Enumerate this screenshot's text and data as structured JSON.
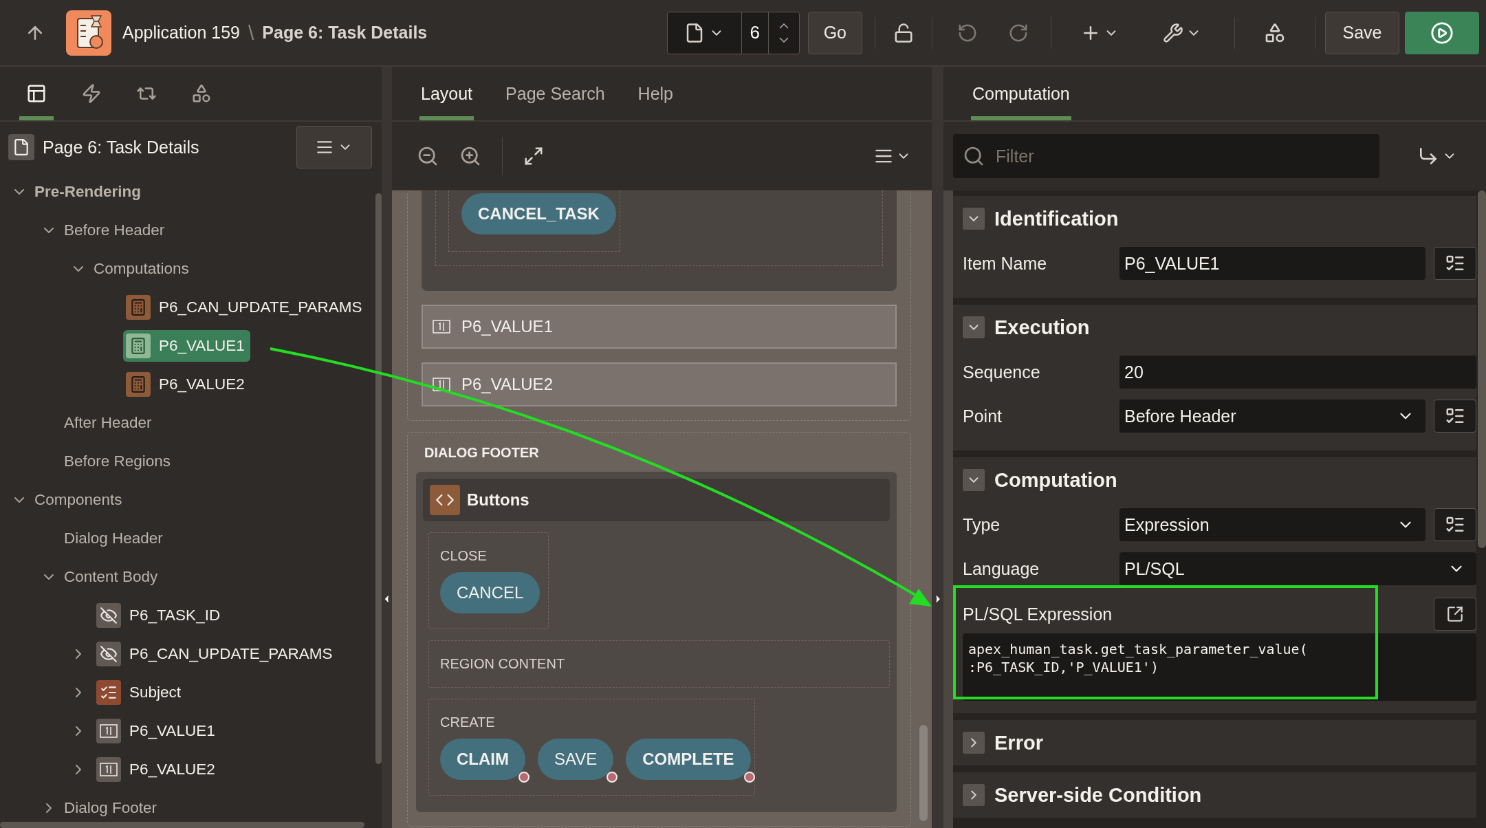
{
  "header": {
    "app": "Application 159",
    "separator": "\\",
    "page": "Page 6: Task Details",
    "page_number": "6",
    "go": "Go",
    "save": "Save"
  },
  "left_panel": {
    "tabs": [
      {
        "kind": "rendering",
        "selected": true
      },
      {
        "kind": "dynamic-actions",
        "selected": false
      },
      {
        "kind": "processing",
        "selected": false
      },
      {
        "kind": "shared",
        "selected": false
      }
    ],
    "title": "Page 6: Task Details",
    "tree": [
      {
        "label": "Pre-Rendering",
        "bold": true,
        "expanded": true,
        "selected": false,
        "children": [
          {
            "label": "Before Header",
            "expanded": true,
            "selected": false,
            "children": [
              {
                "label": "Computations",
                "expanded": true,
                "selected": false,
                "children": [
                  {
                    "label": "P6_CAN_UPDATE_PARAMS",
                    "kind": "computation",
                    "selected": false
                  },
                  {
                    "label": "P6_VALUE1",
                    "kind": "computation",
                    "selected": true
                  },
                  {
                    "label": "P6_VALUE2",
                    "kind": "computation",
                    "selected": false
                  }
                ]
              }
            ]
          },
          {
            "label": "After Header",
            "selected": false
          },
          {
            "label": "Before Regions",
            "selected": false
          }
        ]
      },
      {
        "label": "Components",
        "bold": false,
        "expanded": true,
        "selected": false,
        "children": [
          {
            "label": "Dialog Header",
            "selected": false
          },
          {
            "label": "Content Body",
            "expanded": true,
            "selected": false,
            "children": [
              {
                "label": "P6_TASK_ID",
                "kind": "hidden",
                "selected": false
              },
              {
                "label": "P6_CAN_UPDATE_PARAMS",
                "kind": "hidden",
                "expanded": false,
                "selected": false
              },
              {
                "label": "Subject",
                "kind": "checklist",
                "expanded": false,
                "selected": false
              },
              {
                "label": "P6_VALUE1",
                "kind": "number",
                "expanded": false,
                "selected": false
              },
              {
                "label": "P6_VALUE2",
                "kind": "number",
                "expanded": false,
                "selected": false
              }
            ]
          },
          {
            "label": "Dialog Footer",
            "expanded": false,
            "selected": false
          }
        ]
      }
    ]
  },
  "middle_panel": {
    "tabs": [
      {
        "label": "Layout",
        "selected": true
      },
      {
        "label": "Page Search",
        "selected": false
      },
      {
        "label": "Help",
        "selected": false
      }
    ],
    "canvas": {
      "top_buttons": [
        {
          "label": "CANCEL_TASK",
          "hot": true,
          "conditional": false
        }
      ],
      "items": [
        {
          "label": "P6_VALUE1"
        },
        {
          "label": "P6_VALUE2"
        }
      ],
      "footer": {
        "title": "DIALOG FOOTER",
        "region": "Buttons",
        "slots": [
          {
            "label": "CLOSE",
            "buttons": [
              {
                "label": "CANCEL",
                "hot": false,
                "conditional": false
              }
            ]
          },
          {
            "label": "REGION CONTENT"
          },
          {
            "label": "CREATE",
            "buttons": [
              {
                "label": "CLAIM",
                "hot": true,
                "conditional": true
              },
              {
                "label": "SAVE",
                "hot": false,
                "conditional": true
              },
              {
                "label": "COMPLETE",
                "hot": true,
                "conditional": true
              }
            ]
          }
        ]
      }
    }
  },
  "right_panel": {
    "tabs": [
      {
        "label": "Computation",
        "selected": true
      }
    ],
    "filter": {
      "placeholder": "Filter"
    },
    "sections": [
      {
        "title": "Identification",
        "expanded": true,
        "fields": [
          {
            "label": "Item Name",
            "kind": "text",
            "value": "P6_VALUE1",
            "list_button": true
          }
        ]
      },
      {
        "title": "Execution",
        "expanded": true,
        "fields": [
          {
            "label": "Sequence",
            "kind": "text",
            "value": "20",
            "list_button": false
          },
          {
            "label": "Point",
            "kind": "select",
            "value": "Before Header",
            "list_button": true
          }
        ]
      },
      {
        "title": "Computation",
        "expanded": true,
        "fields": [
          {
            "label": "Type",
            "kind": "select",
            "value": "Expression",
            "list_button": true
          },
          {
            "label": "Language",
            "kind": "select",
            "value": "PL/SQL",
            "list_button": false
          },
          {
            "label": "PL/SQL Expression",
            "kind": "code",
            "value": "apex_human_task.get_task_parameter_value(\n:P6_TASK_ID,'P_VALUE1')",
            "highlighted": true
          }
        ]
      },
      {
        "title": "Error",
        "expanded": false
      },
      {
        "title": "Server-side Condition",
        "expanded": false
      }
    ]
  }
}
